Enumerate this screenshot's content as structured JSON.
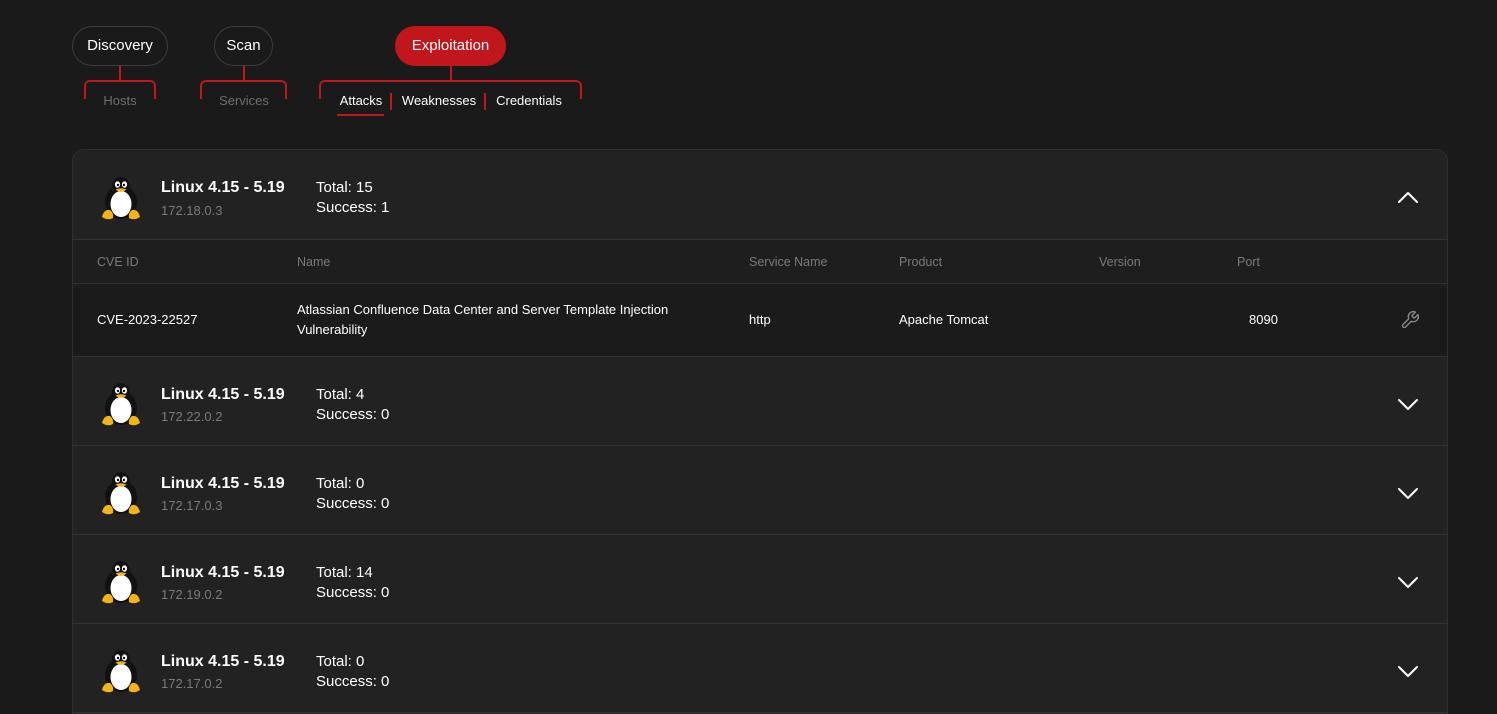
{
  "nav": {
    "discovery": {
      "label": "Discovery",
      "sub": [
        "Hosts"
      ]
    },
    "scan": {
      "label": "Scan",
      "sub": [
        "Services"
      ]
    },
    "exploitation": {
      "label": "Exploitation",
      "sub": [
        "Attacks",
        "Weaknesses",
        "Credentials"
      ],
      "active_sub": "Attacks"
    },
    "active_stage": "Exploitation"
  },
  "colors": {
    "accent": "#c1161c",
    "background": "#1a1a1a",
    "panel": "#222222",
    "muted": "#7a7a7a"
  },
  "table_headers": [
    "CVE ID",
    "Name",
    "Service Name",
    "Product",
    "Version",
    "Port"
  ],
  "hosts": [
    {
      "os": "Linux 4.15 - 5.19",
      "ip": "172.18.0.3",
      "total": "Total: 15",
      "success": "Success: 1",
      "icon": "linux-penguin-icon",
      "expanded": true,
      "rows": [
        {
          "cve": "CVE-2023-22527",
          "name_line1": "Atlassian Confluence Data Center and Server Template Injection",
          "name_line2": "Vulnerability",
          "service": "http",
          "product": "Apache Tomcat",
          "version": "",
          "port": "8090",
          "action_icon": "wrench-icon"
        }
      ]
    },
    {
      "os": "Linux 4.15 - 5.19",
      "ip": "172.22.0.2",
      "total": "Total: 4",
      "success": "Success: 0",
      "icon": "linux-penguin-icon",
      "expanded": false
    },
    {
      "os": "Linux 4.15 - 5.19",
      "ip": "172.17.0.3",
      "total": "Total: 0",
      "success": "Success: 0",
      "icon": "linux-penguin-icon",
      "expanded": false
    },
    {
      "os": "Linux 4.15 - 5.19",
      "ip": "172.19.0.2",
      "total": "Total: 14",
      "success": "Success: 0",
      "icon": "linux-penguin-icon",
      "expanded": false
    },
    {
      "os": "Linux 4.15 - 5.19",
      "ip": "172.17.0.2",
      "total": "Total: 0",
      "success": "Success: 0",
      "icon": "linux-penguin-icon",
      "expanded": false
    }
  ]
}
